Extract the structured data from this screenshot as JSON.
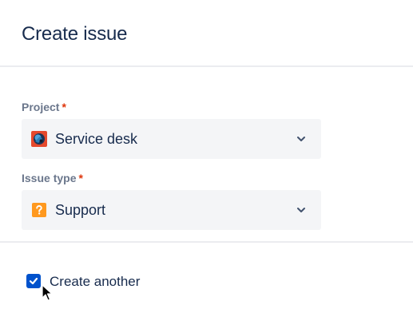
{
  "dialog": {
    "title": "Create issue"
  },
  "fields": {
    "project": {
      "label": "Project",
      "required_mark": "*",
      "value": "Service desk",
      "icon": "service-desk-project-icon"
    },
    "issue_type": {
      "label": "Issue type",
      "required_mark": "*",
      "value": "Support",
      "icon": "question-mark-icon"
    }
  },
  "footer": {
    "create_another_label": "Create another",
    "create_another_checked": true
  },
  "colors": {
    "required": "#DE350B",
    "checkbox": "#0052CC",
    "select_bg": "#F4F5F7",
    "label": "#6B778C",
    "text": "#172B4D",
    "issue_type_icon": "#FF991F"
  }
}
